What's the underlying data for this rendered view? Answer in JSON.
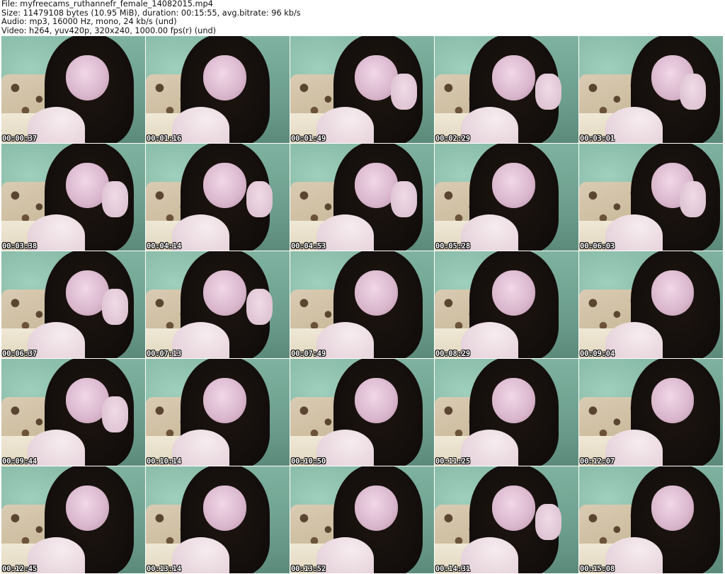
{
  "header": {
    "file_line": "File: myfreecams_ruthannefr_female_14082015.mp4",
    "size_line": "Size: 11479108 bytes (10.95 MiB), duration: 00:15:55, avg.bitrate: 96 kb/s",
    "audio_line": "Audio: mp3, 16000 Hz, mono, 24 kb/s (und)",
    "video_line": "Video: h264, yuv420p, 320x240, 1000.00 fps(r) (und)"
  },
  "thumbnails": [
    {
      "timestamp": "00:00:37"
    },
    {
      "timestamp": "00:01:16"
    },
    {
      "timestamp": "00:01:49"
    },
    {
      "timestamp": "00:02:29"
    },
    {
      "timestamp": "00:03:01"
    },
    {
      "timestamp": "00:03:38"
    },
    {
      "timestamp": "00:04:14"
    },
    {
      "timestamp": "00:04:53"
    },
    {
      "timestamp": "00:05:28"
    },
    {
      "timestamp": "00:06:03"
    },
    {
      "timestamp": "00:06:37"
    },
    {
      "timestamp": "00:07:13"
    },
    {
      "timestamp": "00:07:49"
    },
    {
      "timestamp": "00:08:29"
    },
    {
      "timestamp": "00:09:04"
    },
    {
      "timestamp": "00:09:44"
    },
    {
      "timestamp": "00:10:14"
    },
    {
      "timestamp": "00:10:50"
    },
    {
      "timestamp": "00:11:25"
    },
    {
      "timestamp": "00:12:07"
    },
    {
      "timestamp": "00:12:45"
    },
    {
      "timestamp": "00:13:14"
    },
    {
      "timestamp": "00:13:52"
    },
    {
      "timestamp": "00:14:31"
    },
    {
      "timestamp": "00:15:08"
    }
  ]
}
